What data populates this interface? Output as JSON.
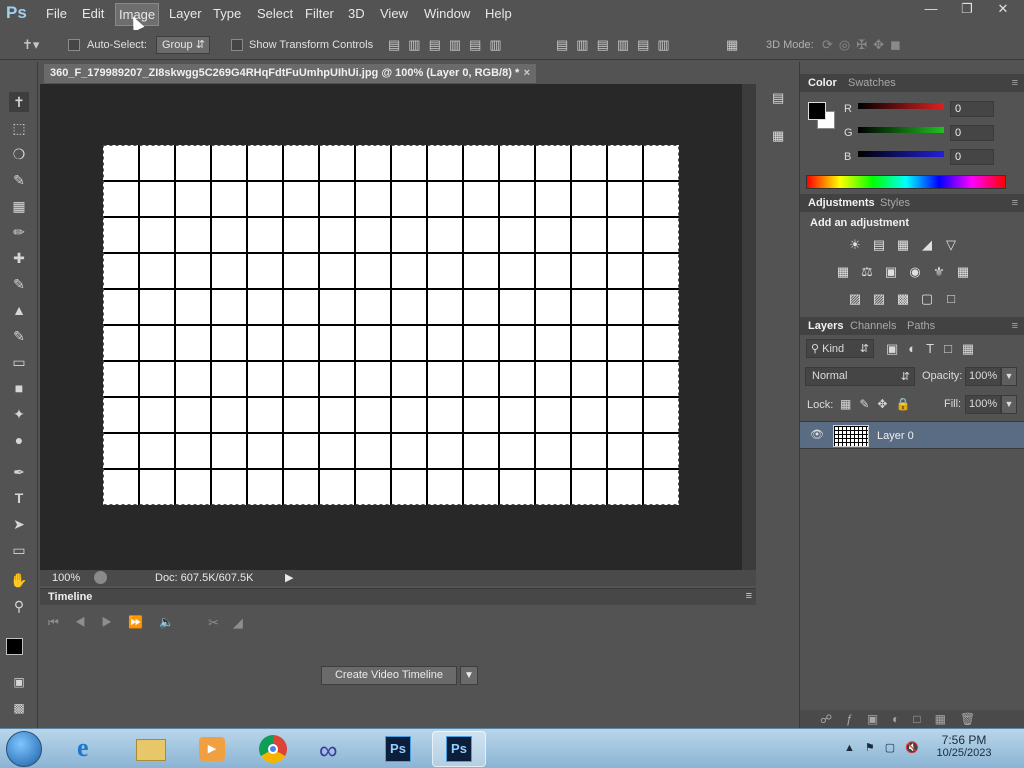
{
  "menubar": {
    "logo": "Ps",
    "items": [
      "File",
      "Edit",
      "Image",
      "Layer",
      "Type",
      "Select",
      "Filter",
      "3D",
      "View",
      "Window",
      "Help"
    ]
  },
  "options": {
    "auto_select_label": "Auto-Select:",
    "group_value": "Group",
    "show_transform_label": "Show Transform Controls",
    "mode_3d_label": "3D Mode:"
  },
  "document": {
    "tab_title": "360_F_179989207_ZI8skwgg5C269G4RHqFdtFuUmhpUIhUi.jpg @ 100% (Layer 0, RGB/8) *",
    "zoom": "100%",
    "doc_size": "Doc: 607.5K/607.5K"
  },
  "timeline": {
    "title": "Timeline",
    "create_button": "Create Video Timeline"
  },
  "color_panel": {
    "tabs": [
      "Color",
      "Swatches"
    ],
    "channels": [
      {
        "label": "R",
        "value": "0",
        "color": "#e02020"
      },
      {
        "label": "G",
        "value": "0",
        "color": "#20c020"
      },
      {
        "label": "B",
        "value": "0",
        "color": "#2020e0"
      }
    ]
  },
  "adjustments_panel": {
    "tabs": [
      "Adjustments",
      "Styles"
    ],
    "heading": "Add an adjustment"
  },
  "layers_panel": {
    "tabs": [
      "Layers",
      "Channels",
      "Paths"
    ],
    "kind_label": "Kind",
    "blend_mode": "Normal",
    "opacity_label": "Opacity:",
    "opacity_value": "100%",
    "lock_label": "Lock:",
    "fill_label": "Fill:",
    "fill_value": "100%",
    "layers": [
      {
        "name": "Layer 0"
      }
    ]
  },
  "taskbar": {
    "time": "7:56 PM",
    "date": "10/25/2023"
  }
}
